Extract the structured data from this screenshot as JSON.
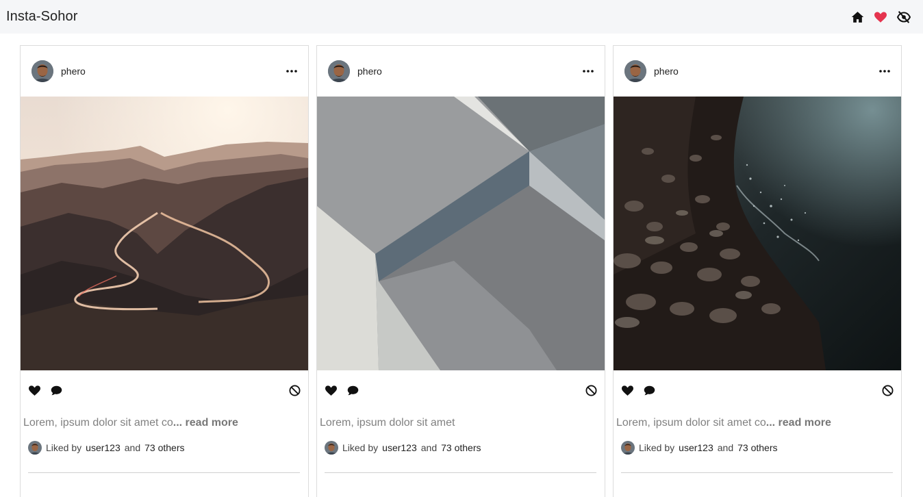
{
  "navbar": {
    "brand": "Insta-Sohor",
    "icons": [
      "home-icon",
      "heart-icon",
      "eye-off-icon"
    ],
    "heart_color": "#e5344f"
  },
  "posts": [
    {
      "username": "phero",
      "image": "mountain-road",
      "caption": "Lorem, ipsum dolor sit amet co",
      "ellipsis": "...",
      "read_more": "read more",
      "liked_by_prefix": "Liked by",
      "liked_by_user": "user123",
      "liked_by_and": "and",
      "liked_by_others": "73 others"
    },
    {
      "username": "phero",
      "image": "abstract-geometry",
      "caption": "Lorem, ipsum dolor sit amet",
      "ellipsis": "",
      "read_more": "",
      "liked_by_prefix": "Liked by",
      "liked_by_user": "user123",
      "liked_by_and": "and",
      "liked_by_others": "73 others"
    },
    {
      "username": "phero",
      "image": "pebble-shore",
      "caption": "Lorem, ipsum dolor sit amet co",
      "ellipsis": "...",
      "read_more": "read more",
      "liked_by_prefix": "Liked by",
      "liked_by_user": "user123",
      "liked_by_and": "and",
      "liked_by_others": "73 others"
    }
  ]
}
